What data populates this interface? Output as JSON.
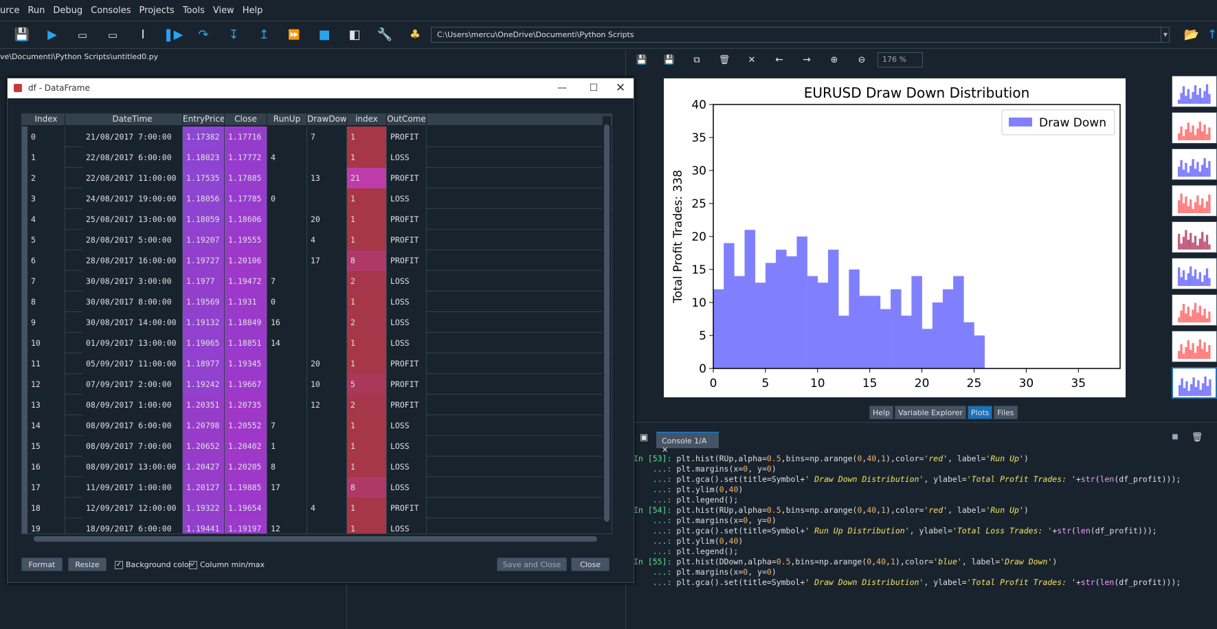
{
  "menu": [
    "urce",
    "Run",
    "Debug",
    "Consoles",
    "Projects",
    "Tools",
    "View",
    "Help"
  ],
  "toolbar": {
    "path": "C:\\Users\\mercu\\OneDrive\\Documenti\\Python Scripts"
  },
  "editor": {
    "path": "ve\\Documenti\\Python Scripts\\untitled0.py"
  },
  "plots": {
    "zoom": "176 %",
    "tabs": [
      "Help",
      "Variable Explorer",
      "Plots",
      "Files"
    ],
    "active_tab": "Plots"
  },
  "chart_data": {
    "type": "bar",
    "title": "EURUSD Draw Down Distribution",
    "xlabel": "",
    "ylabel": "Total Profit Trades: 338",
    "legend": [
      "Draw Down"
    ],
    "legend_position": "top-right",
    "color": "#8080ff",
    "xlim": [
      0,
      39
    ],
    "ylim": [
      0,
      40
    ],
    "xticks": [
      0,
      5,
      10,
      15,
      20,
      25,
      30,
      35
    ],
    "yticks": [
      0,
      5,
      10,
      15,
      20,
      25,
      30,
      35,
      40
    ],
    "bins": [
      0,
      1,
      2,
      3,
      4,
      5,
      6,
      7,
      8,
      9,
      10,
      11,
      12,
      13,
      14,
      15,
      16,
      17,
      18,
      19,
      20,
      21,
      22,
      23,
      24,
      25
    ],
    "values": [
      12,
      19,
      14,
      21,
      13,
      16,
      18,
      17,
      20,
      14,
      13,
      18,
      8,
      15,
      11,
      11,
      9,
      12,
      8,
      14,
      6,
      10,
      12,
      14,
      7,
      5
    ]
  },
  "console": {
    "tab": "Console 1/A",
    "lines": [
      {
        "p": "In [53]:",
        "c": " plt.hist(RUp,alpha=0.5,bins=np.arange(0,40,1),color='red', label='Run Up')"
      },
      {
        "p": "    ...:",
        "c": " plt.margins(x=0, y=0)"
      },
      {
        "p": "    ...:",
        "c": " plt.gca().set(title=Symbol+' Draw Down Distribution', ylabel='Total Profit Trades: '+str(len(df_profit)));"
      },
      {
        "p": "    ...:",
        "c": " plt.ylim(0,40)"
      },
      {
        "p": "    ...:",
        "c": " plt.legend();"
      },
      {
        "p": "",
        "c": ""
      },
      {
        "p": "In [54]:",
        "c": " plt.hist(RUp,alpha=0.5,bins=np.arange(0,40,1),color='red', label='Run Up')"
      },
      {
        "p": "    ...:",
        "c": " plt.margins(x=0, y=0)"
      },
      {
        "p": "    ...:",
        "c": " plt.gca().set(title=Symbol+' Run Up Distribution', ylabel='Total Loss Trades: '+str(len(df_profit)));"
      },
      {
        "p": "    ...:",
        "c": " plt.ylim(0,40)"
      },
      {
        "p": "    ...:",
        "c": " plt.legend();"
      },
      {
        "p": "",
        "c": ""
      },
      {
        "p": "In [55]:",
        "c": " plt.hist(DDown,alpha=0.5,bins=np.arange(0,40,1),color='blue', label='Draw Down')"
      },
      {
        "p": "    ...:",
        "c": " plt.margins(x=0, y=0)"
      },
      {
        "p": "    ...:",
        "c": " plt.gca().set(title=Symbol+' Draw Down Distribution', ylabel='Total Profit Trades: '+str(len(df_profit)));"
      }
    ]
  },
  "dataframe": {
    "title": "df - DataFrame",
    "columns": [
      "Index",
      "DateTime",
      "EntryPrice",
      "Close",
      "RunUp",
      "DrawDow",
      "index",
      "OutCome"
    ],
    "rows": [
      [
        "0",
        "21/08/2017 7:00:00",
        "1.17382",
        "1.17716",
        "",
        "7",
        "1",
        "PROFIT"
      ],
      [
        "1",
        "22/08/2017 6:00:00",
        "1.18023",
        "1.17772",
        "4",
        "",
        "1",
        "LOSS"
      ],
      [
        "2",
        "22/08/2017 11:00:00",
        "1.17535",
        "1.17885",
        "",
        "13",
        "21",
        "PROFIT"
      ],
      [
        "3",
        "24/08/2017 19:00:00",
        "1.18056",
        "1.17785",
        "0",
        "",
        "1",
        "LOSS"
      ],
      [
        "4",
        "25/08/2017 13:00:00",
        "1.18059",
        "1.18606",
        "",
        "20",
        "1",
        "PROFIT"
      ],
      [
        "5",
        "28/08/2017 5:00:00",
        "1.19207",
        "1.19555",
        "",
        "4",
        "1",
        "PROFIT"
      ],
      [
        "6",
        "28/08/2017 16:00:00",
        "1.19727",
        "1.20106",
        "",
        "17",
        "8",
        "PROFIT"
      ],
      [
        "7",
        "30/08/2017 3:00:00",
        "1.1977",
        "1.19472",
        "7",
        "",
        "2",
        "LOSS"
      ],
      [
        "8",
        "30/08/2017 8:00:00",
        "1.19569",
        "1.1931",
        "0",
        "",
        "1",
        "LOSS"
      ],
      [
        "9",
        "30/08/2017 14:00:00",
        "1.19132",
        "1.18849",
        "16",
        "",
        "2",
        "LOSS"
      ],
      [
        "10",
        "01/09/2017 13:00:00",
        "1.19065",
        "1.18851",
        "14",
        "",
        "1",
        "LOSS"
      ],
      [
        "11",
        "05/09/2017 11:00:00",
        "1.18977",
        "1.19345",
        "",
        "20",
        "1",
        "PROFIT"
      ],
      [
        "12",
        "07/09/2017 2:00:00",
        "1.19242",
        "1.19667",
        "",
        "10",
        "5",
        "PROFIT"
      ],
      [
        "13",
        "08/09/2017 1:00:00",
        "1.20351",
        "1.20735",
        "",
        "12",
        "2",
        "PROFIT"
      ],
      [
        "14",
        "08/09/2017 6:00:00",
        "1.20798",
        "1.20552",
        "7",
        "",
        "1",
        "LOSS"
      ],
      [
        "15",
        "08/09/2017 7:00:00",
        "1.20652",
        "1.20402",
        "1",
        "",
        "1",
        "LOSS"
      ],
      [
        "16",
        "08/09/2017 13:00:00",
        "1.20427",
        "1.20205",
        "8",
        "",
        "1",
        "LOSS"
      ],
      [
        "17",
        "11/09/2017 1:00:00",
        "1.20127",
        "1.19885",
        "17",
        "",
        "8",
        "LOSS"
      ],
      [
        "18",
        "12/09/2017 12:00:00",
        "1.19322",
        "1.19654",
        "",
        "4",
        "1",
        "PROFIT"
      ],
      [
        "19",
        "18/09/2017 6:00:00",
        "1.19441",
        "1.19197",
        "12",
        "",
        "1",
        "LOSS"
      ]
    ],
    "buttons": {
      "format": "Format",
      "resize": "Resize",
      "save_close": "Save and Close",
      "close": "Close"
    },
    "checks": {
      "bg": "Background color",
      "minmax": "Column min/max"
    }
  }
}
